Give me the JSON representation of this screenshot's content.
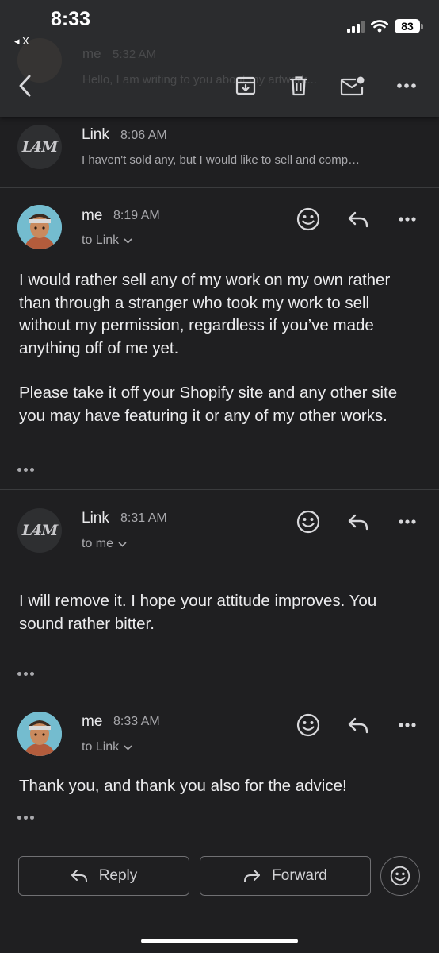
{
  "status_bar": {
    "time": "8:33",
    "back_label": "◂ X",
    "battery": "83"
  },
  "background_thread": {
    "sender": "me",
    "time": "5:32 AM",
    "snippet": "Hello, I am writing to you about my artwork..."
  },
  "colors": {
    "background": "#1f1f21",
    "toolbar": "#2b2c2e",
    "text_primary": "#ececee",
    "text_secondary": "#a9a9ad",
    "divider": "#3a3b3d"
  },
  "toolbar": {
    "icons": [
      "back-chevron-icon",
      "archive-icon",
      "trash-icon",
      "mark-unread-icon",
      "more-icon"
    ]
  },
  "messages": [
    {
      "sender": "Link",
      "avatar_text": "L4M",
      "time": "8:06 AM",
      "snippet": "I haven't sold any, but I would like to sell and comp…"
    },
    {
      "sender": "me",
      "time": "8:19 AM",
      "recipient": "to Link",
      "body_p1": "I would rather sell any of my work on my own rather than through a stranger who took my work to sell without my permission, regardless if you’ve made anything off of me yet.",
      "body_p2": "Please take it off your Shopify site and any other site you may have featuring it or any of my other works."
    },
    {
      "sender": "Link",
      "avatar_text": "L4M",
      "time": "8:31 AM",
      "recipient": "to me",
      "body_p1": "I will remove it. I hope your attitude improves. You sound rather bitter."
    },
    {
      "sender": "me",
      "time": "8:33 AM",
      "recipient": "to Link",
      "body_p1": "Thank you, and thank you also for the advice!"
    }
  ],
  "actions": {
    "reply_label": "Reply",
    "forward_label": "Forward"
  }
}
